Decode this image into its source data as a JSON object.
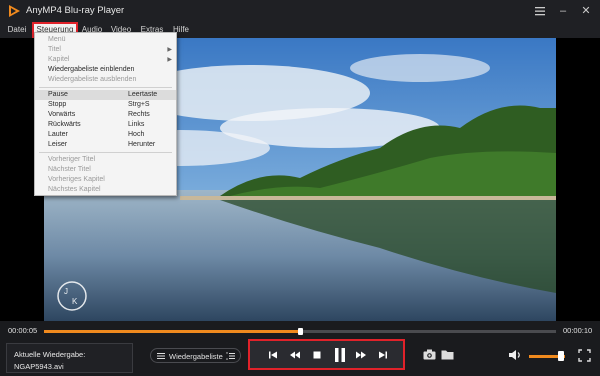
{
  "window": {
    "title": "AnyMP4 Blu-ray Player",
    "controls": {
      "menu_icon": "hamburger-icon",
      "minimize": "–",
      "close": "✕"
    }
  },
  "menubar": {
    "items": [
      "Datei",
      "Steuerung",
      "Audio",
      "Video",
      "Extras",
      "Hilfe"
    ],
    "active_index": 1
  },
  "dropdown": {
    "items": [
      {
        "label": "Menü",
        "shortcut": "",
        "disabled": true
      },
      {
        "label": "Titel",
        "shortcut": "",
        "disabled": true,
        "submenu": true
      },
      {
        "label": "Kapitel",
        "shortcut": "",
        "disabled": true,
        "submenu": true
      },
      {
        "label": "Wiedergabeliste einblenden",
        "shortcut": "",
        "disabled": false
      },
      {
        "label": "Wiedergabeliste ausblenden",
        "shortcut": "",
        "disabled": true
      },
      {
        "label": "Pause",
        "shortcut": "Leertaste",
        "disabled": false,
        "highlighted": true
      },
      {
        "label": "Stopp",
        "shortcut": "Strg+S",
        "disabled": false
      },
      {
        "label": "Vorwärts",
        "shortcut": "Rechts",
        "disabled": false
      },
      {
        "label": "Rückwärts",
        "shortcut": "Links",
        "disabled": false
      },
      {
        "label": "Lauter",
        "shortcut": "Hoch",
        "disabled": false
      },
      {
        "label": "Leiser",
        "shortcut": "Herunter",
        "disabled": false
      },
      {
        "label": "Vorheriger Titel",
        "shortcut": "",
        "disabled": true
      },
      {
        "label": "Nächster Titel",
        "shortcut": "",
        "disabled": true
      },
      {
        "label": "Vorheriges Kapitel",
        "shortcut": "",
        "disabled": true
      },
      {
        "label": "Nächstes Kapitel",
        "shortcut": "",
        "disabled": true
      }
    ]
  },
  "playback": {
    "current_time": "00:00:05",
    "total_time": "00:00:10",
    "progress": 0.5,
    "volume": 0.9
  },
  "now_playing": {
    "label": "Aktuelle Wiedergabe:",
    "file": "NGAP5943.avi"
  },
  "playlist_button": {
    "label": "Wiedergabeliste"
  },
  "transport": {
    "buttons": [
      "previous-icon",
      "rewind-icon",
      "stop-icon",
      "pause-icon",
      "fast-forward-icon",
      "next-icon"
    ]
  },
  "colors": {
    "accent": "#f08a1e",
    "highlight_border": "#e0222a"
  }
}
